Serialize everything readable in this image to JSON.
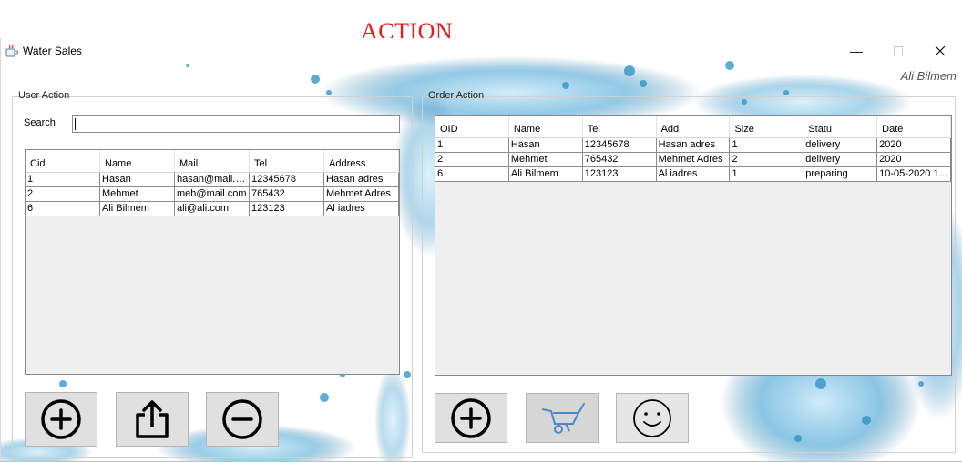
{
  "caption": "ACTION",
  "window": {
    "title": "Water Sales",
    "icons": {
      "app": "java-cup-icon",
      "minimize": "minimize-icon",
      "maximize": "maximize-icon",
      "close": "close-icon"
    }
  },
  "current_user": "Ali Bilmem",
  "user_action": {
    "legend": "User Action",
    "search_label": "Search",
    "search_value": "",
    "columns": [
      "Cid",
      "Name",
      "Mail",
      "Tel",
      "Address"
    ],
    "rows": [
      [
        "1",
        "Hasan",
        "hasan@mail.c...",
        "12345678",
        "Hasan adres"
      ],
      [
        "2",
        "Mehmet",
        "meh@mail.com",
        "765432",
        "Mehmet Adres"
      ],
      [
        "6",
        "Ali Bilmem",
        "ali@ali.com",
        "123123",
        "Al iadres"
      ]
    ],
    "buttons": [
      {
        "name": "add-user-button",
        "icon": "plus-circle-icon"
      },
      {
        "name": "update-user-button",
        "icon": "upload-icon"
      },
      {
        "name": "delete-user-button",
        "icon": "minus-circle-icon"
      }
    ]
  },
  "order_action": {
    "legend": "Order Action",
    "columns": [
      "OID",
      "Name",
      "Tel",
      "Add",
      "Size",
      "Statu",
      "Date"
    ],
    "rows": [
      [
        "1",
        "Hasan",
        "12345678",
        "Hasan adres",
        "1",
        "delivery",
        "2020"
      ],
      [
        "2",
        "Mehmet",
        "765432",
        "Mehmet Adres",
        "2",
        "delivery",
        "2020"
      ],
      [
        "6",
        "Ali Bilmem",
        "123123",
        "Al iadres",
        "1",
        "preparing",
        "10-05-2020 1..."
      ]
    ],
    "buttons": [
      {
        "name": "add-order-button",
        "icon": "plus-circle-icon"
      },
      {
        "name": "deliver-order-button",
        "icon": "wheelbarrow-icon"
      },
      {
        "name": "smile-button",
        "icon": "smiley-icon"
      }
    ]
  },
  "colors": {
    "caption": "#e02020",
    "water": "#2a8fc4",
    "button_bg": "#e0e0e0"
  }
}
